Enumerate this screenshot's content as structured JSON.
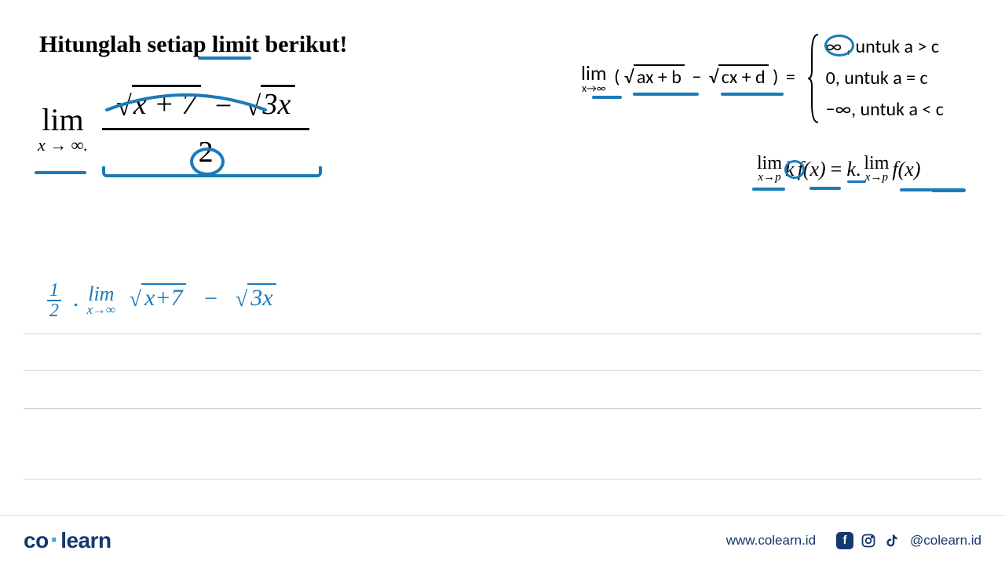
{
  "title": "Hitunglah setiap limit berikut!",
  "main_limit": {
    "lim": "lim",
    "sub": "x → ∞.",
    "top_sqrt1_arg": "x  +  7",
    "minus": "−",
    "top_sqrt2_arg": "3x",
    "bottom": "2"
  },
  "rule": {
    "lim": "lim",
    "sub": "x→∞",
    "sqrt1": "ax + b",
    "sqrt2": "cx + d",
    "eq": "=",
    "case1_lhs": "∞",
    "case1_rhs": "untuk  a > c",
    "case2_lhs": "0,",
    "case2_rhs": "untuk  a = c",
    "case3_lhs": "−∞,",
    "case3_rhs": "untuk  a < c"
  },
  "scalar": {
    "lim": "lim",
    "sub": "x→p",
    "k": "k",
    "fx": "f(x)",
    "eq": "=",
    "dot": "."
  },
  "hw": {
    "half_n": "1",
    "half_d": "2",
    "dot": ".",
    "lim": "lim",
    "sub": "x→∞",
    "sq1_arg": "x+7",
    "minus": "−",
    "sq2_arg": "3x"
  },
  "footer": {
    "logo_co": "co",
    "logo_learn": "learn",
    "url": "www.colearn.id",
    "handle": "@colearn.id"
  }
}
